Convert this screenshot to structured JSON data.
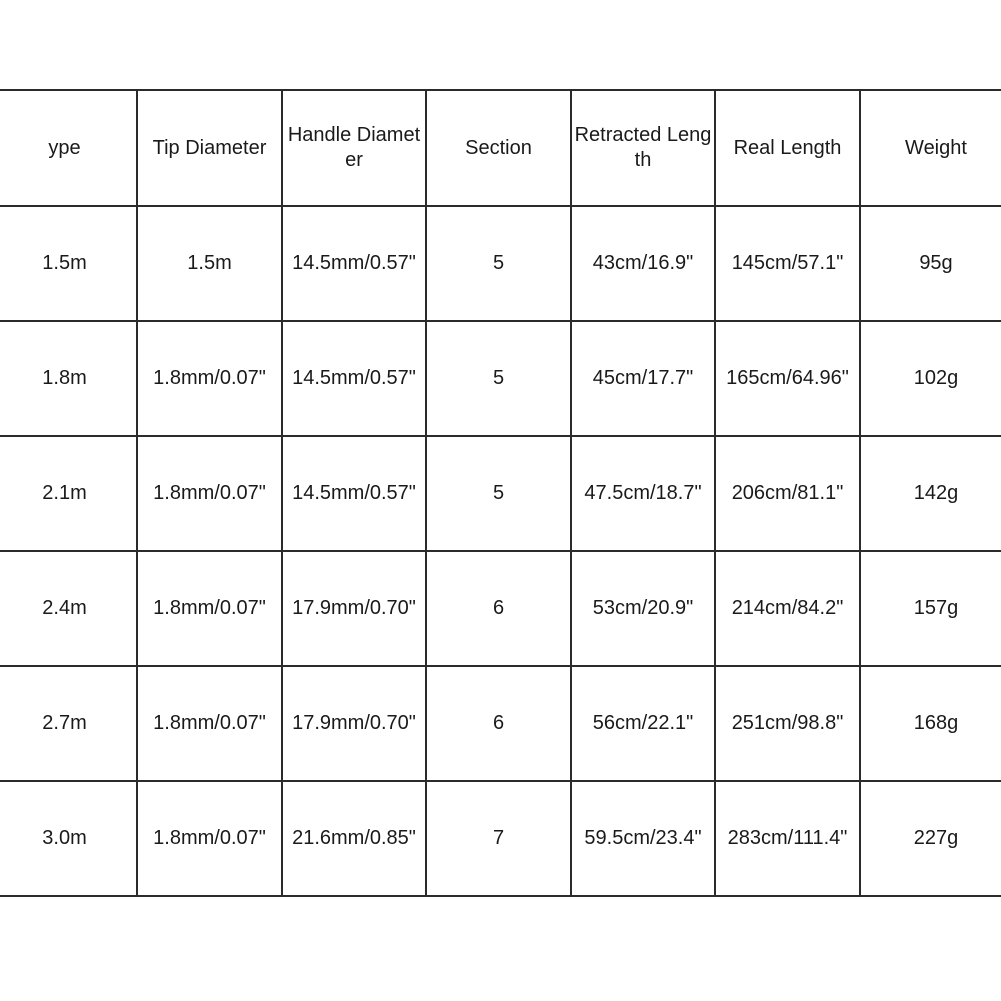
{
  "table": {
    "columns": [
      "ype",
      "Tip Diameter",
      "Handle Diameter",
      "Section",
      "Retracted Length",
      "Real Length",
      "Weight"
    ],
    "rows": [
      [
        "1.5m",
        "1.5m",
        "14.5mm/0.57\"",
        "5",
        "43cm/16.9\"",
        "145cm/57.1\"",
        "95g"
      ],
      [
        "1.8m",
        "1.8mm/0.07\"",
        "14.5mm/0.57\"",
        "5",
        "45cm/17.7\"",
        "165cm/64.96\"",
        "102g"
      ],
      [
        "2.1m",
        "1.8mm/0.07\"",
        "14.5mm/0.57\"",
        "5",
        "47.5cm/18.7\"",
        "206cm/81.1\"",
        "142g"
      ],
      [
        "2.4m",
        "1.8mm/0.07\"",
        "17.9mm/0.70\"",
        "6",
        "53cm/20.9\"",
        "214cm/84.2\"",
        "157g"
      ],
      [
        "2.7m",
        "1.8mm/0.07\"",
        "17.9mm/0.70\"",
        "6",
        "56cm/22.1\"",
        "251cm/98.8\"",
        "168g"
      ],
      [
        "3.0m",
        "1.8mm/0.07\"",
        "21.6mm/0.85\"",
        "7",
        "59.5cm/23.4\"",
        "283cm/111.4\"",
        "227g"
      ]
    ]
  },
  "colors": {
    "border": "#2b2b2b",
    "text": "#1a1a1a",
    "background": "#ffffff"
  }
}
